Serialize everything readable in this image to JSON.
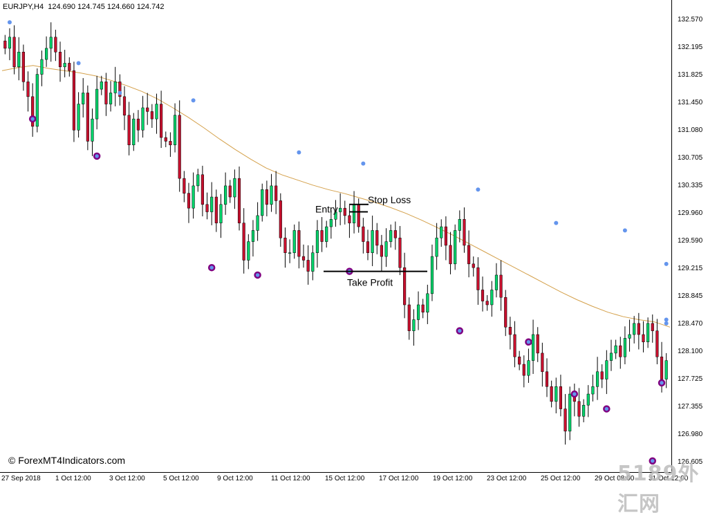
{
  "header": {
    "symbol": "EURJPY,H4",
    "ohlc": "124.690 124.745 124.660 124.742"
  },
  "price_axis": [
    "132.570",
    "132.195",
    "131.825",
    "131.450",
    "131.080",
    "130.705",
    "130.335",
    "129.960",
    "129.590",
    "129.215",
    "128.845",
    "128.470",
    "128.100",
    "127.725",
    "127.355",
    "126.980",
    "126.605"
  ],
  "time_axis": [
    "27 Sep 2018",
    "1 Oct 12:00",
    "3 Oct 12:00",
    "5 Oct 12:00",
    "9 Oct 12:00",
    "11 Oct 12:00",
    "15 Oct 12:00",
    "17 Oct 12:00",
    "19 Oct 12:00",
    "23 Oct 12:00",
    "25 Oct 12:00",
    "29 Oct 08:00",
    "31 Oct 12:00"
  ],
  "annotations": {
    "stop_loss": "Stop Loss",
    "entry": "Entry",
    "take_profit": "Take Profit"
  },
  "watermark": "© ForexMT4Indicators.com",
  "brand_mark": "5189外汇网",
  "colors": {
    "bull": "#00d26a",
    "bear": "#c8102e",
    "ma": "#d4a04a",
    "fractal_up": "#6495ed",
    "fractal_signal": "#800080"
  },
  "chart_data": {
    "type": "candlestick",
    "symbol": "EURJPY",
    "timeframe": "H4",
    "ylim": [
      126.45,
      132.8
    ],
    "x_tick_labels": [
      "27 Sep 2018",
      "1 Oct 12:00",
      "3 Oct 12:00",
      "5 Oct 12:00",
      "9 Oct 12:00",
      "11 Oct 12:00",
      "15 Oct 12:00",
      "17 Oct 12:00",
      "19 Oct 12:00",
      "23 Oct 12:00",
      "25 Oct 12:00",
      "29 Oct 08:00",
      "31 Oct 12:00"
    ],
    "closes": [
      132.15,
      132.3,
      131.9,
      132.1,
      131.7,
      131.5,
      131.1,
      131.8,
      132.0,
      132.15,
      132.3,
      132.1,
      131.9,
      131.95,
      131.85,
      131.05,
      131.4,
      131.55,
      130.9,
      131.2,
      131.6,
      131.7,
      131.4,
      131.55,
      131.7,
      131.5,
      131.25,
      130.85,
      131.2,
      131.05,
      131.35,
      131.3,
      131.2,
      131.4,
      130.95,
      130.9,
      130.85,
      131.25,
      130.4,
      130.2,
      130.0,
      130.3,
      130.45,
      130.05,
      129.95,
      130.15,
      129.8,
      130.05,
      130.3,
      130.15,
      130.4,
      129.8,
      129.3,
      129.55,
      129.7,
      129.9,
      130.25,
      130.05,
      130.3,
      130.1,
      129.6,
      129.4,
      129.4,
      129.7,
      129.35,
      129.3,
      129.15,
      129.4,
      129.7,
      129.55,
      129.75,
      129.85,
      129.95,
      130.0,
      129.9,
      129.8,
      130.05,
      129.75,
      129.55,
      129.4,
      129.7,
      129.5,
      129.35,
      129.55,
      129.7,
      129.6,
      129.2,
      128.7,
      128.35,
      128.5,
      128.7,
      128.6,
      128.85,
      129.35,
      129.6,
      129.75,
      129.5,
      129.25,
      129.7,
      129.85,
      129.5,
      129.25,
      129.2,
      128.9,
      128.75,
      128.7,
      128.9,
      129.1,
      128.8,
      128.4,
      128.3,
      128.0,
      127.9,
      127.75,
      127.95,
      128.3,
      128.05,
      127.8,
      127.6,
      127.4,
      127.6,
      127.3,
      127.0,
      127.5,
      127.4,
      127.2,
      127.35,
      127.5,
      127.6,
      127.8,
      127.7,
      127.95,
      128.05,
      128.15,
      128.0,
      128.25,
      128.3,
      128.45,
      128.3,
      128.2,
      128.45,
      128.35,
      128.0,
      127.7,
      127.95
    ],
    "moving_average": {
      "color": "#d4a04a",
      "values": [
        131.85,
        131.89,
        131.92,
        131.88,
        131.85,
        131.82,
        131.78,
        131.72,
        131.65,
        131.57,
        131.47,
        131.35,
        131.22,
        131.08,
        130.93,
        130.79,
        130.66,
        130.54,
        130.45,
        130.38,
        130.31,
        130.25,
        130.2,
        130.14,
        130.08,
        130.01,
        129.93,
        129.84,
        129.74,
        129.64,
        129.53,
        129.42,
        129.31,
        129.2,
        129.09,
        128.98,
        128.87,
        128.77,
        128.68,
        128.6,
        128.54,
        128.5,
        128.47,
        128.4
      ]
    },
    "fractals_up": [
      132.5,
      131.95,
      131.55,
      131.45,
      130.75,
      130.6,
      130.25,
      129.8,
      129.7,
      129.25,
      128.45,
      128.5
    ],
    "fractals_down": [
      131.2,
      130.7,
      129.2,
      129.1,
      129.15,
      128.35,
      128.2,
      127.5,
      127.3,
      126.6,
      127.65
    ],
    "signals": {
      "stop_loss": 130.05,
      "entry": 129.95,
      "take_profit": 129.15
    }
  }
}
